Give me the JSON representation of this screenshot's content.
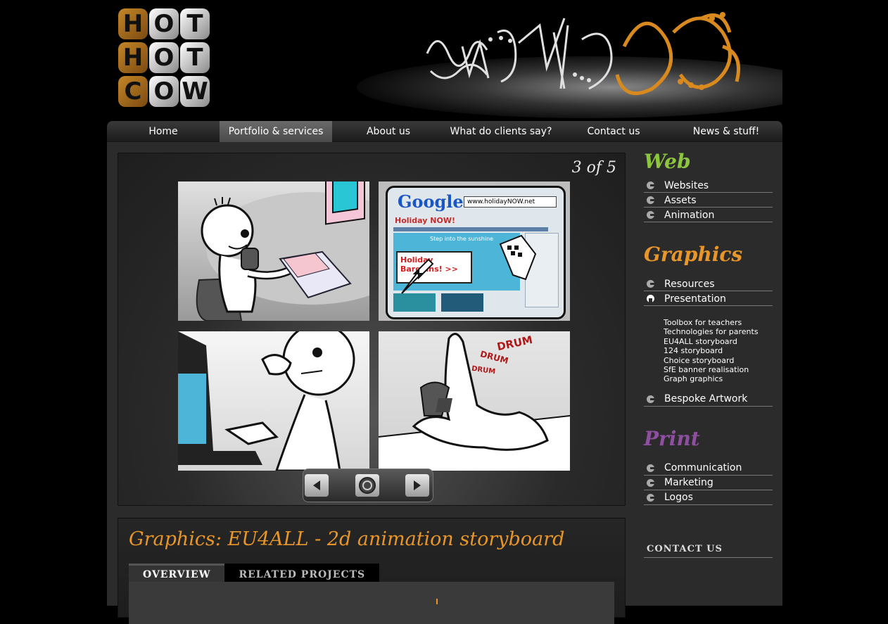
{
  "logo": {
    "rows": [
      [
        "H",
        "O",
        "T"
      ],
      [
        "H",
        "O",
        "T"
      ],
      [
        "C",
        "O",
        "W"
      ]
    ]
  },
  "nav": {
    "items": [
      "Home",
      "Portfolio & services",
      "About us",
      "What do clients say?",
      "Contact us",
      "News & stuff!"
    ],
    "active_index": 1
  },
  "viewer": {
    "counter": "3 of 5",
    "panel2": {
      "google": "Google",
      "url": "www.holidayNOW.net",
      "heading": "Holiday NOW!",
      "tagline": "Step into the sunshine",
      "bargains": "Holiday Bargains! >>"
    },
    "panel4": {
      "words": [
        "DRUM",
        "DRUM",
        "DRUM"
      ]
    }
  },
  "info": {
    "title": "Graphics: EU4ALL - 2d animation storyboard",
    "tabs": [
      "OVERVIEW",
      "RELATED PROJECTS"
    ],
    "active_tab": 0
  },
  "sidebar": {
    "web": {
      "title": "Web",
      "color": "#8cc63f",
      "items": [
        "Websites",
        "Assets",
        "Animation"
      ]
    },
    "graphics": {
      "title": "Graphics",
      "color": "#e8962a",
      "items": [
        "Resources",
        "Presentation"
      ],
      "sub_items": [
        "Toolbox for teachers",
        "Technologies for parents",
        "EU4ALL storyboard",
        "124 storyboard",
        "Choice storyboard",
        "SfE banner realisation",
        "Graph graphics"
      ],
      "extra_item": "Bespoke Artwork"
    },
    "print": {
      "title": "Print",
      "color": "#8e4fa0",
      "items": [
        "Communication",
        "Marketing",
        "Logos"
      ]
    },
    "contact": "CONTACT US"
  },
  "colors": {
    "accent": "#e8962a",
    "background": "#000000",
    "content_bg": "#2b2b2b"
  }
}
